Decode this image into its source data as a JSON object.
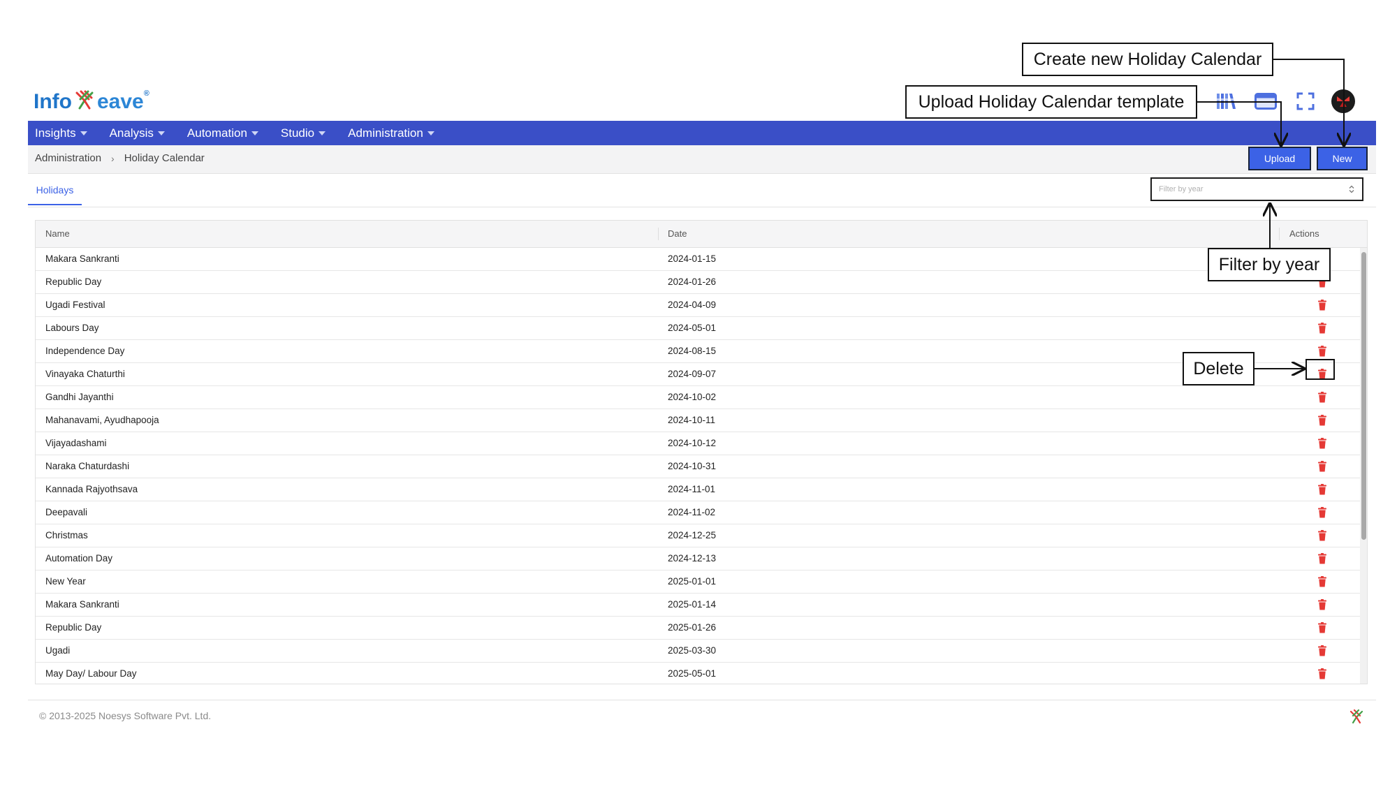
{
  "brand": {
    "logo_text_left": "Info",
    "logo_text_right": "eave",
    "logo_tm": "®"
  },
  "topbar": {
    "icons": [
      "apps-icon",
      "monitor-icon",
      "fullscreen-icon"
    ],
    "avatar": "avatar-logo"
  },
  "nav": {
    "items": [
      {
        "label": "Insights"
      },
      {
        "label": "Analysis"
      },
      {
        "label": "Automation"
      },
      {
        "label": "Studio"
      },
      {
        "label": "Administration"
      }
    ]
  },
  "breadcrumb": {
    "parent": "Administration",
    "current": "Holiday Calendar"
  },
  "toolbar": {
    "upload_label": "Upload",
    "new_label": "New"
  },
  "tabs": [
    {
      "label": "Holidays",
      "active": true
    }
  ],
  "filter": {
    "placeholder": "Filter by year"
  },
  "table": {
    "columns": {
      "name": "Name",
      "date": "Date",
      "actions": "Actions"
    },
    "rows": [
      {
        "name": "Makara Sankranti",
        "date": "2024-01-15"
      },
      {
        "name": "Republic Day",
        "date": "2024-01-26"
      },
      {
        "name": "Ugadi Festival",
        "date": "2024-04-09"
      },
      {
        "name": "Labours Day",
        "date": "2024-05-01"
      },
      {
        "name": "Independence Day",
        "date": "2024-08-15"
      },
      {
        "name": "Vinayaka Chaturthi",
        "date": "2024-09-07"
      },
      {
        "name": "Gandhi Jayanthi",
        "date": "2024-10-02"
      },
      {
        "name": "Mahanavami, Ayudhapooja",
        "date": "2024-10-11"
      },
      {
        "name": "Vijayadashami",
        "date": "2024-10-12"
      },
      {
        "name": "Naraka Chaturdashi",
        "date": "2024-10-31"
      },
      {
        "name": "Kannada Rajyothsava",
        "date": "2024-11-01"
      },
      {
        "name": "Deepavali",
        "date": "2024-11-02"
      },
      {
        "name": "Christmas",
        "date": "2024-12-25"
      },
      {
        "name": "Automation Day",
        "date": "2024-12-13"
      },
      {
        "name": "New Year",
        "date": "2025-01-01"
      },
      {
        "name": "Makara Sankranti",
        "date": "2025-01-14"
      },
      {
        "name": "Republic Day",
        "date": "2025-01-26"
      },
      {
        "name": "Ugadi",
        "date": "2025-03-30"
      },
      {
        "name": "May Day/ Labour Day",
        "date": "2025-05-01"
      }
    ],
    "delete_icon": "trash-icon",
    "delete_color": "#e53935"
  },
  "footer": {
    "copyright": "© 2013-2025 Noesys Software Pvt. Ltd."
  },
  "annotations": {
    "new": "Create new Holiday Calendar",
    "upload": "Upload Holiday Calendar template",
    "filter": "Filter by year",
    "delete": "Delete"
  },
  "colors": {
    "nav_bg": "#3a4fc7",
    "button_bg": "#3c62e6",
    "accent": "#3c62e6"
  }
}
